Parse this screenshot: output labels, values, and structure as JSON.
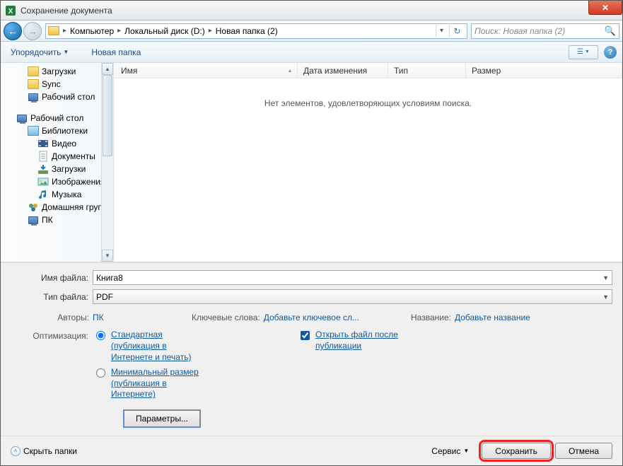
{
  "title": "Сохранение документа",
  "close_glyph": "✕",
  "nav": {
    "back": "←",
    "fwd": "→"
  },
  "breadcrumbs": [
    "Компьютер",
    "Локальный диск (D:)",
    "Новая папка (2)"
  ],
  "refresh": "↻",
  "search": {
    "placeholder": "Поиск: Новая папка (2)",
    "icon": "🔍"
  },
  "toolbar": {
    "organize": "Упорядочить",
    "newfolder": "Новая папка",
    "view_glyph": "☰",
    "help": "?"
  },
  "sidebar": {
    "quick": [
      {
        "label": "Загрузки",
        "icon": "folder"
      },
      {
        "label": "Sync",
        "icon": "folder"
      },
      {
        "label": "Рабочий стол",
        "icon": "monitor"
      }
    ],
    "desktop_label": "Рабочий стол",
    "libraries_label": "Библиотеки",
    "libs": [
      {
        "label": "Видео"
      },
      {
        "label": "Документы"
      },
      {
        "label": "Загрузки"
      },
      {
        "label": "Изображения"
      },
      {
        "label": "Музыка"
      }
    ],
    "home_label": "Домашняя групп",
    "pc_label": "ПК"
  },
  "columns": {
    "name": "Имя",
    "date": "Дата изменения",
    "type": "Тип",
    "size": "Размер"
  },
  "empty": "Нет элементов, удовлетворяющих условиям поиска.",
  "fields": {
    "filename_label": "Имя файла:",
    "filename_value": "Книга8",
    "filetype_label": "Тип файла:",
    "filetype_value": "PDF"
  },
  "meta": {
    "authors_label": "Авторы:",
    "authors_value": "ПК",
    "keywords_label": "Ключевые слова:",
    "keywords_value": "Добавьте ключевое сл...",
    "title_label": "Название:",
    "title_value": "Добавьте название"
  },
  "optimize": {
    "label": "Оптимизация:",
    "standard": "Стандартная (публикация в Интернете и печать)",
    "minimum": "Минимальный размер (публикация в Интернете)",
    "openafter": "Открыть файл после публикации",
    "params": "Параметры..."
  },
  "footer": {
    "hide": "Скрыть папки",
    "service": "Сервис",
    "save": "Сохранить",
    "cancel": "Отмена"
  }
}
